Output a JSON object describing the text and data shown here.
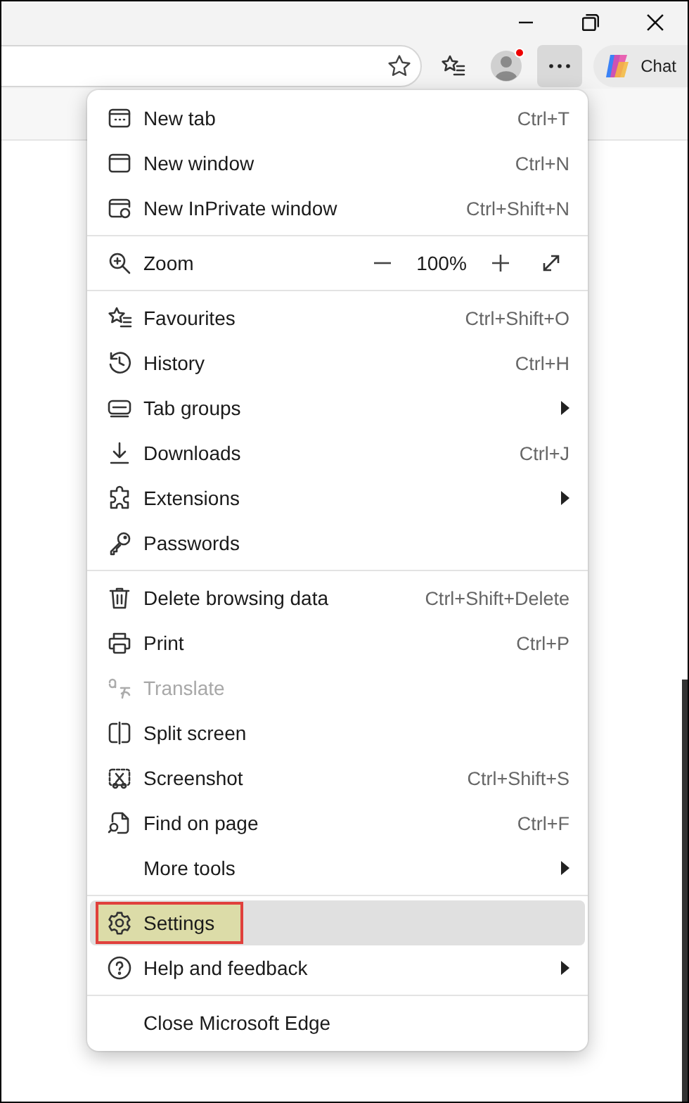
{
  "toolbar": {
    "chat_label": "Chat",
    "more_pressed": true,
    "profile_notification": true
  },
  "menu": {
    "sections": [
      [
        {
          "kind": "item",
          "label": "New tab",
          "shortcut": "Ctrl+T",
          "submenu": false,
          "disabled": false,
          "selected": false
        },
        {
          "kind": "item",
          "label": "New window",
          "shortcut": "Ctrl+N",
          "submenu": false,
          "disabled": false,
          "selected": false
        },
        {
          "kind": "item",
          "label": "New InPrivate window",
          "shortcut": "Ctrl+Shift+N",
          "submenu": false,
          "disabled": false,
          "selected": false
        }
      ],
      [
        {
          "kind": "zoom",
          "label": "Zoom",
          "value": "100%"
        }
      ],
      [
        {
          "kind": "item",
          "label": "Favourites",
          "shortcut": "Ctrl+Shift+O",
          "submenu": false,
          "disabled": false,
          "selected": false
        },
        {
          "kind": "item",
          "label": "History",
          "shortcut": "Ctrl+H",
          "submenu": false,
          "disabled": false,
          "selected": false
        },
        {
          "kind": "item",
          "label": "Tab groups",
          "submenu": true,
          "disabled": false,
          "selected": false
        },
        {
          "kind": "item",
          "label": "Downloads",
          "shortcut": "Ctrl+J",
          "submenu": false,
          "disabled": false,
          "selected": false
        },
        {
          "kind": "item",
          "label": "Extensions",
          "submenu": true,
          "disabled": false,
          "selected": false
        },
        {
          "kind": "item",
          "label": "Passwords",
          "submenu": false,
          "disabled": false,
          "selected": false
        }
      ],
      [
        {
          "kind": "item",
          "label": "Delete browsing data",
          "shortcut": "Ctrl+Shift+Delete",
          "submenu": false,
          "disabled": false,
          "selected": false
        },
        {
          "kind": "item",
          "label": "Print",
          "shortcut": "Ctrl+P",
          "submenu": false,
          "disabled": false,
          "selected": false
        },
        {
          "kind": "item",
          "label": "Translate",
          "submenu": false,
          "disabled": true,
          "selected": false
        },
        {
          "kind": "item",
          "label": "Split screen",
          "submenu": false,
          "disabled": false,
          "selected": false
        },
        {
          "kind": "item",
          "label": "Screenshot",
          "shortcut": "Ctrl+Shift+S",
          "submenu": false,
          "disabled": false,
          "selected": false
        },
        {
          "kind": "item",
          "label": "Find on page",
          "shortcut": "Ctrl+F",
          "submenu": false,
          "disabled": false,
          "selected": false
        },
        {
          "kind": "item",
          "label": "More tools",
          "submenu": true,
          "disabled": false,
          "selected": false
        }
      ],
      [
        {
          "kind": "item",
          "label": "Settings",
          "submenu": false,
          "disabled": false,
          "selected": true
        },
        {
          "kind": "item",
          "label": "Help and feedback",
          "submenu": true,
          "disabled": false,
          "selected": false
        }
      ],
      [
        {
          "kind": "item",
          "label": "Close Microsoft Edge",
          "submenu": false,
          "disabled": false,
          "selected": false
        }
      ]
    ]
  }
}
